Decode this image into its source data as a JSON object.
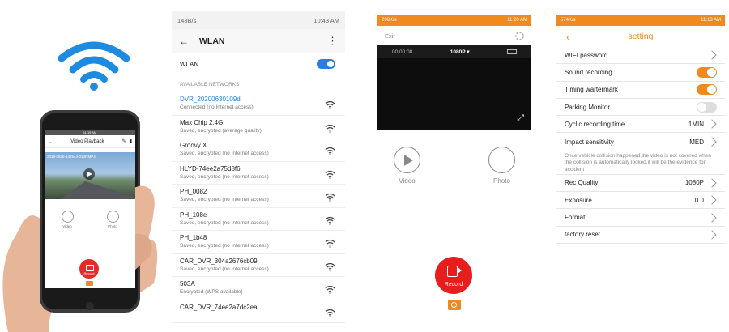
{
  "hand_phone": {
    "status": "11:19 AM",
    "title": "Video Playback",
    "file_name": "2019-0828-142544-014F.MP4",
    "video_label": "Video",
    "photo_label": "Photo",
    "record_label": "Record"
  },
  "wlan": {
    "status_left": "148B/s",
    "status_right": "10:43 AM",
    "title": "WLAN",
    "toggle_label": "WLAN",
    "toggle_on": true,
    "section_header": "AVAILABLE NETWORKS",
    "networks": [
      {
        "name": "DVR_20200630109d",
        "status": "Connected (no Internet access)"
      },
      {
        "name": "Max Chip 2.4G",
        "status": "Saved, encrypted (average quality)"
      },
      {
        "name": "Groovy X",
        "status": "Saved, encrypted (no Internet access)"
      },
      {
        "name": "HLYD-74ee2a75d8f6",
        "status": "Saved, encrypted (no Internet access)"
      },
      {
        "name": "PH_0082",
        "status": "Saved, encrypted (no Internet access)"
      },
      {
        "name": "PH_108e",
        "status": "Saved, encrypted (no Internet access)"
      },
      {
        "name": "PH_1b48",
        "status": "Saved, encrypted (no Internet access)"
      },
      {
        "name": "CAR_DVR_304a2676cb09",
        "status": "Saved, encrypted (no Internet access)"
      },
      {
        "name": "503A",
        "status": "Encrypted (WPS available)"
      },
      {
        "name": "CAR_DVR_74ee2a7dc2ea",
        "status": ""
      }
    ]
  },
  "live": {
    "status_left": "298K/s",
    "status_right": "11:20 AM",
    "exit_label": "Exit",
    "timer": "00:00:08",
    "resolution": "1080P",
    "video_label": "Video",
    "photo_label": "Photo",
    "record_label": "Record"
  },
  "settings": {
    "status_left": "574K/s",
    "status_right": "11:13 AM",
    "title": "setting",
    "rows": {
      "wifi_password": "WIFI password",
      "sound_recording": "Sound recording",
      "timing_watermark": "Timing wartermark",
      "parking_monitor": "Parking Monitor",
      "cyclic_recording": "Cyclic recording time",
      "cyclic_value": "1MIN",
      "impact_sensitivity": "Impact sensitivity",
      "impact_value": "MED",
      "impact_note": "Once vehicle collision happened,the video is not covered when the collision is automatically locked,it will be the evidence for accident",
      "rec_quality": "Rec Quality",
      "rec_quality_value": "1080P",
      "exposure": "Exposure",
      "exposure_value": "0.0",
      "format": "Format",
      "factory_reset": "factory reset"
    },
    "toggles": {
      "sound_recording": true,
      "timing_watermark": true,
      "parking_monitor": false
    }
  },
  "colors": {
    "accent_orange": "#f08a1e",
    "wifi_blue": "#2a7ee0",
    "record_red": "#e81d1d"
  }
}
